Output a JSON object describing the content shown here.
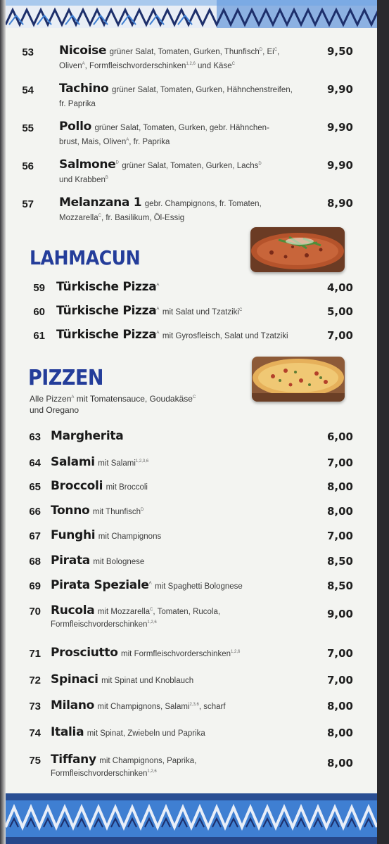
{
  "colors": {
    "accent": "#243d9a",
    "border_blue": "#3f7fd2",
    "border_dark": "#1d2f6b"
  },
  "salads": [
    {
      "num": "53",
      "name": "Nicoise",
      "desc1": "grüner Salat, Tomaten, Gurken, Thunfisch",
      "sup1": "D",
      "desc1b": ", Ei",
      "sup1b": "C",
      "desc1c": ",",
      "desc2": "Oliven",
      "sup2": "A",
      "desc2b": ", Formfleischvorderschinken",
      "sup2b": "1,2,6",
      "desc2c": " und Käse",
      "sup2c": "C",
      "price": "9,50"
    },
    {
      "num": "54",
      "name": "Tachino",
      "desc1": "grüner Salat, Tomaten, Gurken, Hähnchenstreifen,",
      "desc2": "fr. Paprika",
      "price": "9,90"
    },
    {
      "num": "55",
      "name": "Pollo",
      "desc1": "grüner Salat, Tomaten, Gurken, gebr. Hähnchen-",
      "desc2": "brust, Mais, Oliven",
      "sup2": "A",
      "desc2b": ", fr. Paprika",
      "price": "9,90"
    },
    {
      "num": "56",
      "name": "Salmone",
      "namesup": "D",
      "desc1": "grüner Salat, Tomaten, Gurken, Lachs",
      "sup1": "D",
      "desc2": "und Krabben",
      "sup2": "B",
      "price": "9,90"
    },
    {
      "num": "57",
      "name": "Melanzana 1",
      "desc1": "gebr. Champignons, fr. Tomaten,",
      "desc2": "Mozzarella",
      "sup2": "C",
      "desc2b": ", fr. Basilikum, Öl-Essig",
      "price": "8,90"
    }
  ],
  "lahmacun": {
    "title": "LAHMACUN",
    "items": [
      {
        "num": "59",
        "name": "Türkische Pizza",
        "namesup": "A",
        "desc": "",
        "price": "4,00"
      },
      {
        "num": "60",
        "name": "Türkische Pizza",
        "namesup": "A",
        "desc": "mit Salat und Tzatziki",
        "descsup": "C",
        "price": "5,00"
      },
      {
        "num": "61",
        "name": "Türkische Pizza",
        "namesup": "A",
        "desc": "mit Gyrosfleisch, Salat und Tzatziki",
        "price": "7,00"
      }
    ]
  },
  "pizzen": {
    "title": "PIZZEN",
    "intro1": "Alle Pizzen",
    "intro1sup": "A",
    "intro1b": " mit Tomatensauce, Goudakäse",
    "intro1bsup": "C",
    "intro2": "und Oregano",
    "items": [
      {
        "num": "63",
        "name": "Margherita",
        "desc": "",
        "price": "6,00"
      },
      {
        "num": "64",
        "name": "Salami",
        "desc": "mit Salami",
        "descsup": "1,2,3,6",
        "price": "7,00"
      },
      {
        "num": "65",
        "name": "Broccoli",
        "desc": "mit Broccoli",
        "price": "8,00"
      },
      {
        "num": "66",
        "name": "Tonno",
        "desc": "mit Thunfisch",
        "descsup": "D",
        "price": "8,00"
      },
      {
        "num": "67",
        "name": "Funghi",
        "desc": "mit Champignons",
        "price": "7,00"
      },
      {
        "num": "68",
        "name": "Pirata",
        "desc": "mit Bolognese",
        "price": "8,50"
      },
      {
        "num": "69",
        "name": "Pirata Speziale",
        "namesup": "A",
        "desc": "mit Spaghetti Bolognese",
        "price": "8,50"
      },
      {
        "num": "70",
        "name": "Rucola",
        "desc": "mit Mozzarella",
        "descsup": "C",
        "descb": ", Tomaten, Rucola,",
        "desc2": "Formfleischvorderschinken",
        "desc2sup": "1,2,6",
        "price": "9,00"
      },
      {
        "num": "71",
        "name": "Prosciutto",
        "desc": "mit Formfleischvorderschinken",
        "descsup": "1,2,6",
        "price": "7,00"
      },
      {
        "num": "72",
        "name": "Spinaci",
        "desc": "mit Spinat und Knoblauch",
        "price": "7,00"
      },
      {
        "num": "73",
        "name": "Milano",
        "desc": "mit Champignons, Salami",
        "descsup": "2,3,6",
        "descb": ", scharf",
        "price": "8,00"
      },
      {
        "num": "74",
        "name": "Italia",
        "desc": "mit Spinat, Zwiebeln und Paprika",
        "price": "8,00"
      },
      {
        "num": "75",
        "name": "Tiffany",
        "desc": "mit Champignons, Paprika,",
        "desc2": "Formfleischvorderschinken",
        "desc2sup": "1,2,6",
        "price": "8,00"
      }
    ]
  }
}
